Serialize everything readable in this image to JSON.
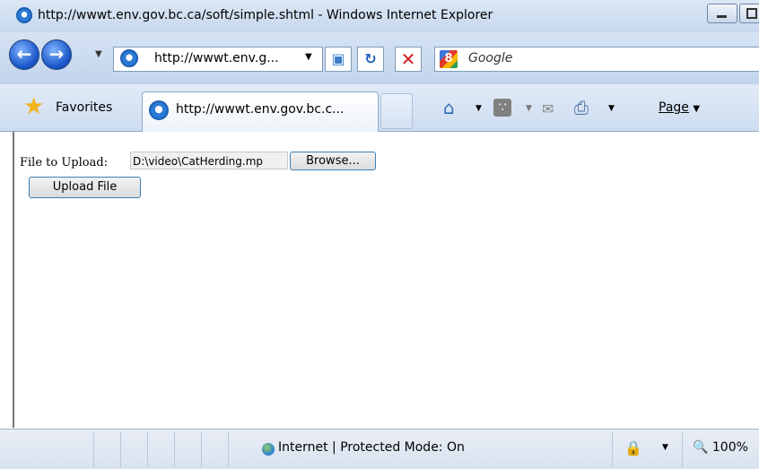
{
  "window": {
    "title": "http://wwwt.env.gov.bc.ca/soft/simple.shtml - Windows Internet Explorer"
  },
  "nav": {
    "address_display": "http://wwwt.env.g...",
    "search_placeholder": "Google"
  },
  "favorites_bar": {
    "favorites_label": "Favorites",
    "tab_title": "http://wwwt.env.gov.bc.c...",
    "page_menu_label": "Page"
  },
  "form": {
    "file_label": "File to Upload:",
    "file_value": "D:\\video\\CatHerding.mp",
    "browse_label": "Browse...",
    "upload_label": "Upload File"
  },
  "status": {
    "zone": "Internet | Protected Mode: On",
    "zoom": "100%"
  },
  "icons": {
    "ie": "ie-logo-icon",
    "back": "back-arrow-icon",
    "forward": "forward-arrow-icon",
    "stop": "stop-icon",
    "refresh": "refresh-icon",
    "home": "home-icon",
    "rss": "rss-feed-icon",
    "mail": "mail-icon",
    "print": "print-icon",
    "globe": "globe-icon",
    "zoom": "zoom-icon",
    "star": "star-icon"
  }
}
